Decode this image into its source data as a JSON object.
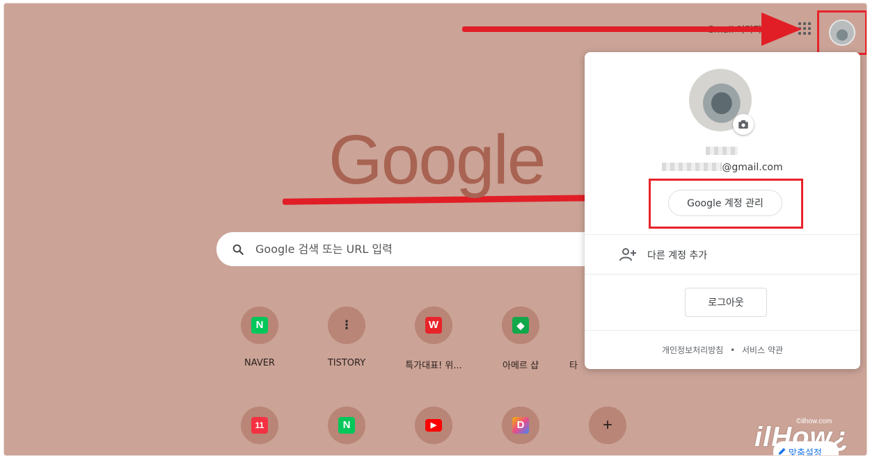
{
  "header": {
    "links_blurred": "Gmail  이미지"
  },
  "logo": {
    "text": "Google"
  },
  "search": {
    "placeholder": "Google 검색 또는 URL 입력"
  },
  "shortcuts_row1": [
    {
      "label": "NAVER",
      "icon": "N"
    },
    {
      "label": "TISTORY",
      "icon": "⁝"
    },
    {
      "label": "특가대표! 위...",
      "icon": "W"
    },
    {
      "label": "아메르 샵",
      "icon": "◆"
    },
    {
      "label": "타",
      "icon": ""
    }
  ],
  "shortcuts_row2": [
    {
      "label": "",
      "icon": "11"
    },
    {
      "label": "",
      "icon": "N"
    },
    {
      "label": "",
      "icon": "▶"
    },
    {
      "label": "",
      "icon": "D"
    },
    {
      "label": "",
      "icon": "+"
    }
  ],
  "account_panel": {
    "email_domain": "@gmail.com",
    "manage_label": "Google 계정 관리",
    "add_account_label": "다른 계정 추가",
    "logout_label": "로그아웃",
    "privacy_label": "개인정보처리방침",
    "separator": "•",
    "terms_label": "서비스 약관"
  },
  "customize": {
    "label": "맞춤설정"
  },
  "watermark": {
    "url": "©ilhow.com",
    "brand": "ilHow¿"
  },
  "colors": {
    "background": "#cba397",
    "logo": "#a86352",
    "arrow": "#e11e26",
    "accent": "#1a73e8"
  }
}
